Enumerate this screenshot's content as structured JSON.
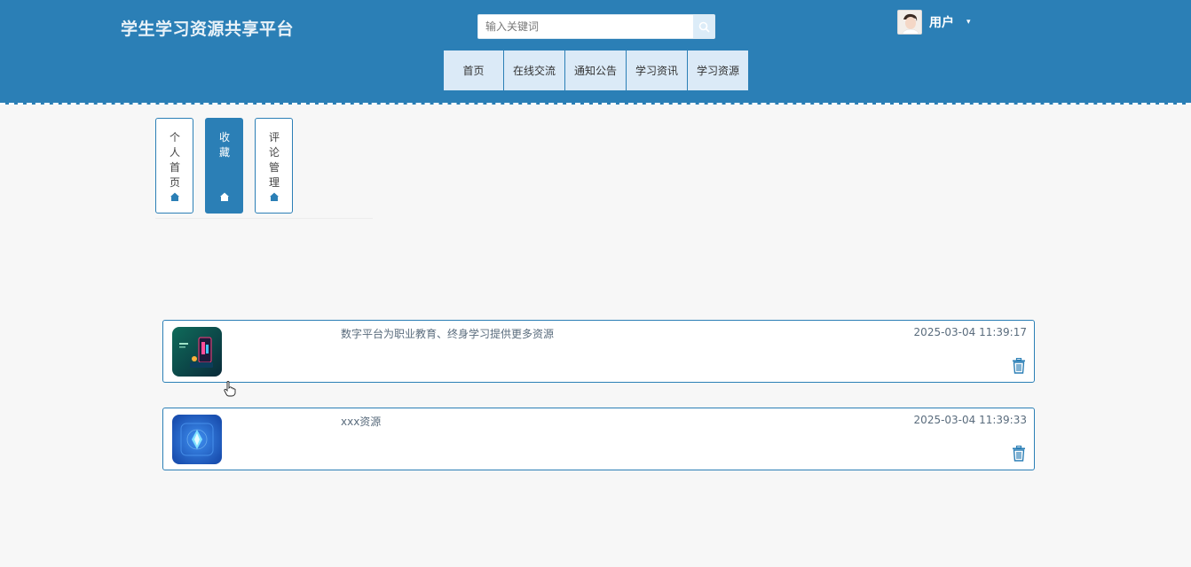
{
  "header": {
    "site_title": "学生学习资源共享平台",
    "search": {
      "placeholder": "输入关键词",
      "value": ""
    },
    "user": {
      "name": "用户",
      "caret": "▾"
    },
    "brand_color": "#2b7fb6"
  },
  "nav": {
    "items": [
      {
        "label": "首页"
      },
      {
        "label": "在线交流"
      },
      {
        "label": "通知公告"
      },
      {
        "label": "学习资讯"
      },
      {
        "label": "学习资源"
      }
    ]
  },
  "side_tabs": [
    {
      "label": "个人首页",
      "icon": "home-icon",
      "active": false
    },
    {
      "label": "收藏",
      "icon": "home-icon",
      "active": true
    },
    {
      "label": "评论管理",
      "icon": "home-icon",
      "active": false
    }
  ],
  "favorites": [
    {
      "title": "数字平台为职业教育、终身学习提供更多资源",
      "time": "2025-03-04 11:39:17",
      "thumb_icon": "phone-app-image",
      "delete_icon": "trash-icon"
    },
    {
      "title": "xxx资源",
      "time": "2025-03-04 11:39:33",
      "thumb_icon": "glowing-crystal-image",
      "delete_icon": "trash-icon"
    }
  ]
}
